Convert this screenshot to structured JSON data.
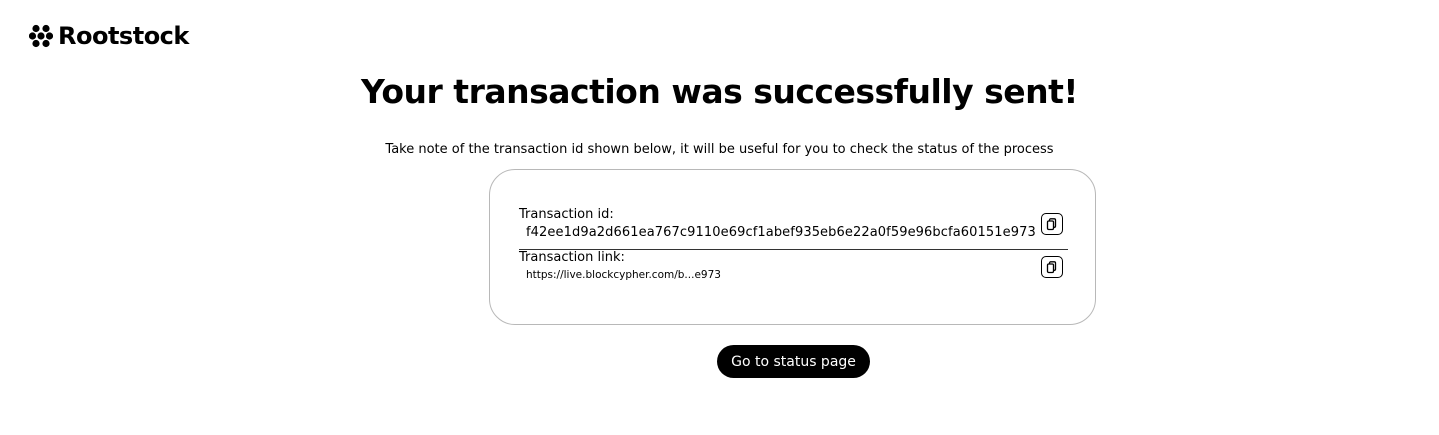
{
  "header": {
    "logo_text": "Rootstock"
  },
  "main": {
    "title": "Your transaction was successfully sent!",
    "subtitle": "Take note of the transaction id shown below, it will be useful for you to check the status of the process",
    "transaction_id": {
      "label": "Transaction id:",
      "value": "f42ee1d9a2d661ea767c9110e69cf1abef935eb6e22a0f59e96bcfa60151e973",
      "copy_icon": "copy-icon"
    },
    "transaction_link": {
      "label": "Transaction link:",
      "value": "https://live.blockcypher.com/b...e973",
      "copy_icon": "copy-icon"
    },
    "status_button_label": "Go to status page"
  }
}
